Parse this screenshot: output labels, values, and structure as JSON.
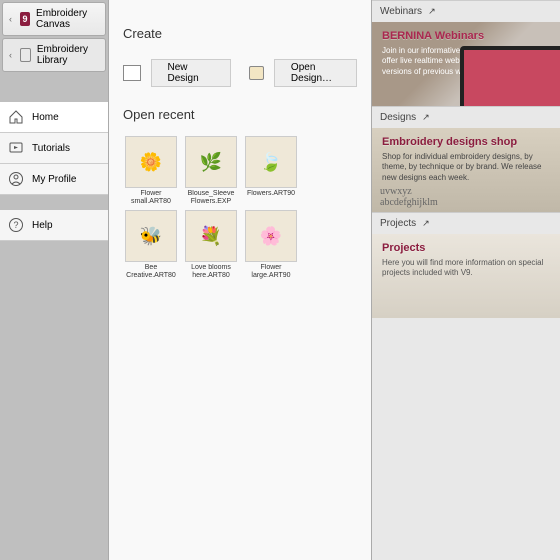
{
  "tabs": {
    "canvas": "Embroidery Canvas",
    "library": "Embroidery Library"
  },
  "nav": {
    "home": "Home",
    "tutorials": "Tutorials",
    "profile": "My Profile",
    "help": "Help"
  },
  "main": {
    "create_heading": "Create",
    "new_design": "New Design",
    "open_design": "Open Design…",
    "recent_heading": "Open recent",
    "recent": [
      {
        "label": "Flower small.ART80"
      },
      {
        "label": "Blouse_Sleeve Flowers.EXP"
      },
      {
        "label": "Flowers.ART90"
      },
      {
        "label": ""
      },
      {
        "label": "Bee Creative.ART80"
      },
      {
        "label": "Love blooms here.ART80"
      },
      {
        "label": "Flower large.ART90"
      }
    ]
  },
  "cards": {
    "webinars": {
      "tab": "Webinars",
      "title": "BERNINA Webinars",
      "desc": "Join in our informative online webinars. We offer live realtime webinars as well as recorded versions of previous webinars."
    },
    "designs": {
      "tab": "Designs",
      "title": "Embroidery designs shop",
      "desc": "Shop for individual embroidery designs, by theme, by technique or by brand. We release new designs each week."
    },
    "projects": {
      "tab": "Projects",
      "title": "Projects",
      "desc": "Here you will find more information on special projects included with V9."
    }
  }
}
